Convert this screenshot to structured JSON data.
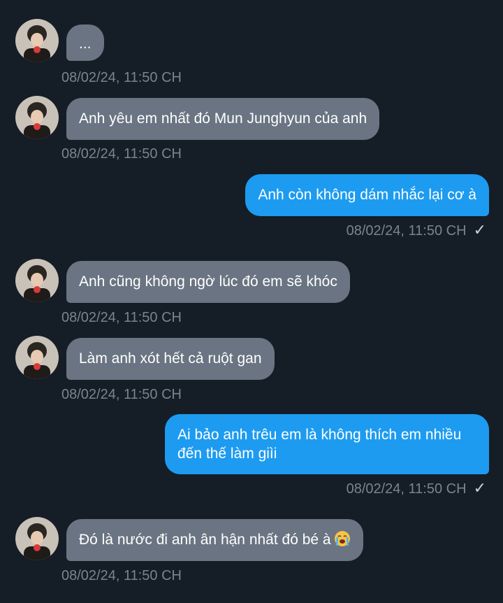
{
  "messages": [
    {
      "direction": "in",
      "text": "...",
      "time": "08/02/24, 11:50 CH"
    },
    {
      "direction": "in",
      "text": "Anh yêu em nhất đó Mun Junghyun của anh",
      "time": "08/02/24, 11:50 CH"
    },
    {
      "direction": "out",
      "text": "Anh còn không dám nhắc lại cơ à",
      "time": "08/02/24, 11:50 CH",
      "status": "✓"
    },
    {
      "direction": "in",
      "text": "Anh cũng không ngờ lúc đó em sẽ khóc",
      "time": "08/02/24, 11:50 CH"
    },
    {
      "direction": "in",
      "text": "Làm anh xót hết cả ruột gan",
      "time": "08/02/24, 11:50 CH"
    },
    {
      "direction": "out",
      "text": "Ai bảo anh trêu em là không thích em nhiều đến thế làm giìi",
      "time": "08/02/24, 11:50 CH",
      "status": "✓"
    },
    {
      "direction": "in",
      "text": "Đó là nước đi anh ân hận nhất đó bé à",
      "emoji": "loudly-crying-face-emoji",
      "time": "08/02/24, 11:50 CH"
    }
  ],
  "colors": {
    "background": "#151d26",
    "incoming_bubble": "#6a7482",
    "outgoing_bubble": "#1d9bf0",
    "timestamp": "#7a8490"
  }
}
